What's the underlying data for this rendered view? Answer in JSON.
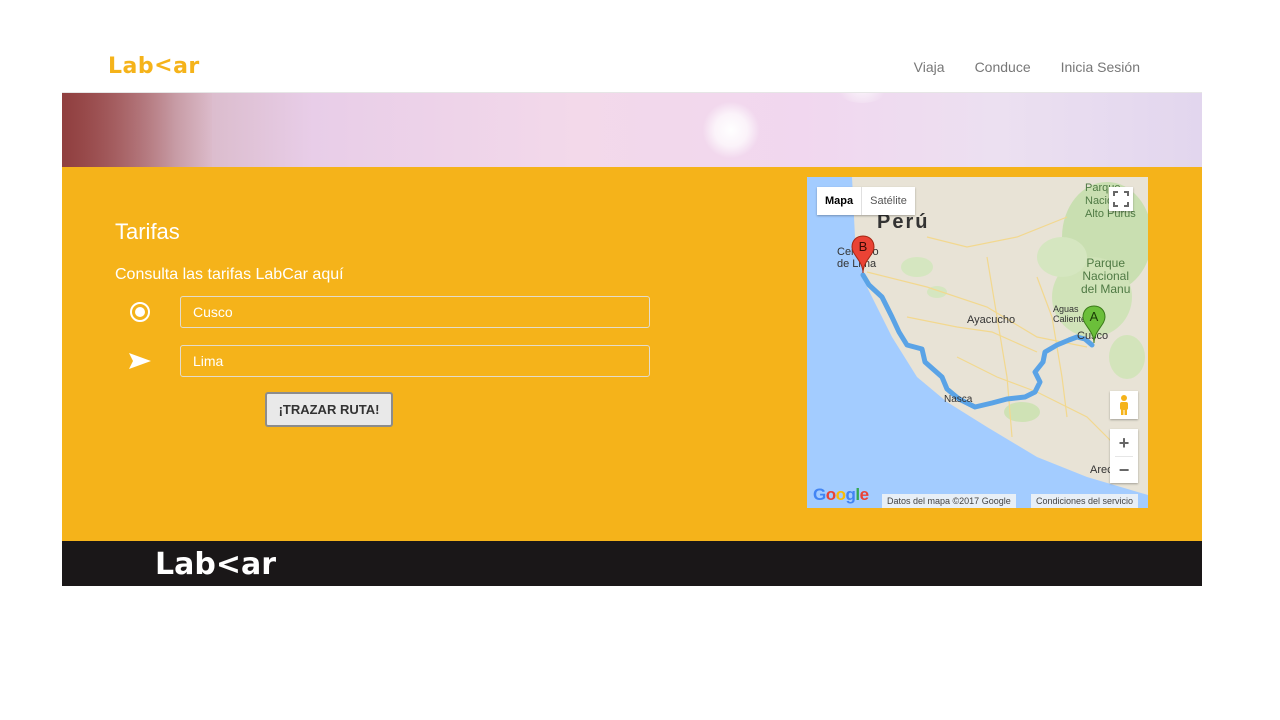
{
  "brand": {
    "logo_text_left": "Lab",
    "logo_chevron": "<",
    "logo_text_right": "ar",
    "accent": "#f5b31a"
  },
  "nav": {
    "items": [
      "Viaja",
      "Conduce",
      "Inicia Sesión"
    ]
  },
  "main": {
    "title": "Tarifas",
    "subtitle": "Consulta las tarifas LabCar aquí",
    "origin": {
      "value": "Cusco",
      "icon": "radio-target-icon"
    },
    "destination": {
      "value": "Lima",
      "icon": "send-arrow-icon"
    },
    "button_label": "¡TRAZAR RUTA!"
  },
  "map": {
    "tabs": [
      "Mapa",
      "Satélite"
    ],
    "labels": {
      "peru": "Perú",
      "lima_line1": "Cercado",
      "lima_line2": "de Lima",
      "parque1": "Parque Nacional Alto Purus",
      "parque2_l1": "Parque",
      "parque2_l2": "Nacional",
      "parque2_l3": "del Manu",
      "ayacucho": "Ayacucho",
      "aguas": "Aguas",
      "calientes": "Calientes",
      "cusco": "Cusco",
      "nasca": "Nasca",
      "arequipa": "Arec"
    },
    "marker_a": "A",
    "marker_b": "B",
    "zoom_in": "+",
    "zoom_out": "−",
    "google": "Google",
    "attribution": "Datos del mapa ©2017 Google",
    "terms": "Condiciones del servicio"
  },
  "footer": {
    "logo_text_left": "Lab",
    "logo_chevron": "<",
    "logo_text_right": "ar"
  }
}
